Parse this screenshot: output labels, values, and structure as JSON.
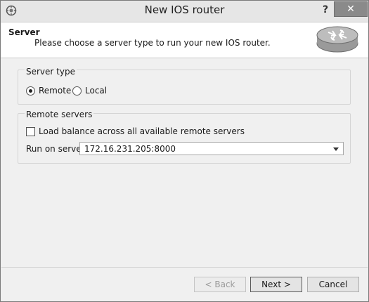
{
  "window": {
    "title": "New IOS router",
    "help_label": "?",
    "close_label": "✕"
  },
  "header": {
    "title": "Server",
    "subtitle": "Please choose a server type to run your new IOS router."
  },
  "server_type": {
    "legend": "Server type",
    "options": [
      {
        "label": "Remote",
        "selected": true
      },
      {
        "label": "Local",
        "selected": false
      }
    ]
  },
  "remote_servers": {
    "legend": "Remote servers",
    "load_balance_label": "Load balance across all available remote servers",
    "load_balance_checked": false,
    "run_on_label": "Run on server:",
    "run_on_value": "172.16.231.205:8000"
  },
  "footer": {
    "back_label": "< Back",
    "next_label": "Next >",
    "cancel_label": "Cancel"
  },
  "colors": {
    "close_button": "#8a8a8a",
    "header_bg": "#ffffff",
    "dialog_bg": "#f0f0f0"
  },
  "icons": [
    "app-icon",
    "router-icon",
    "chevron-down-icon"
  ]
}
